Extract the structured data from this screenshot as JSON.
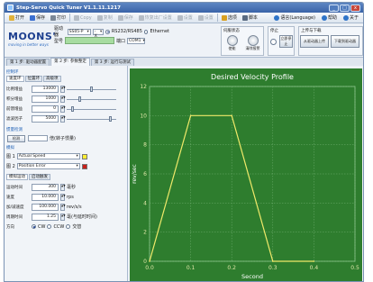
{
  "window": {
    "title": "Step-Servo Quick Tuner V1.1.11.1217",
    "buttons": {
      "minimize": "_",
      "maximize": "□",
      "close": "x"
    }
  },
  "toolbar": {
    "items": [
      {
        "label": "打开",
        "color": "#e1b23a",
        "enabled": true
      },
      {
        "label": "保存",
        "color": "#3b6fd0",
        "enabled": true
      },
      {
        "label": "打印",
        "color": "#7b8796",
        "enabled": true
      },
      {
        "label": "Copy",
        "color": "#b5bcc5",
        "enabled": false
      },
      {
        "label": "复制",
        "color": "#b5bcc5",
        "enabled": false
      },
      {
        "label": "保存",
        "color": "#b5bcc5",
        "enabled": false
      },
      {
        "label": "恢复出厂设置",
        "color": "#b5bcc5",
        "enabled": false
      },
      {
        "label": "设置",
        "color": "#b5bcc5",
        "enabled": false
      },
      {
        "label": "设置",
        "color": "#b5bcc5",
        "enabled": false
      },
      {
        "label": "选项",
        "color": "#d9a021",
        "enabled": true
      },
      {
        "label": "脚本",
        "color": "#5a6b82",
        "enabled": true
      }
    ],
    "right": [
      {
        "label": "语言(Language)",
        "color": "#2f74c8"
      },
      {
        "label": "帮助",
        "color": "#2f74c8"
      },
      {
        "label": "关于",
        "color": "#2f74c8"
      }
    ]
  },
  "config": {
    "brand": "MOONS'",
    "tagline": "moving in better ways",
    "drive_label": "驱动器",
    "drive_value": "SS05-P",
    "drive_option": "-X",
    "comm_options": [
      "RS232/RS485",
      "Ethernet"
    ],
    "selected_comm": "RS232/RS485",
    "model_label": "型号",
    "port_label": "端口",
    "port_value": "COM1",
    "status_group": {
      "title": "伺服状态",
      "buttons": [
        "使能",
        "清除报警"
      ]
    },
    "stop_group": {
      "title": "停止",
      "button": "立即停止"
    },
    "upload_group": {
      "title": "上传与下载",
      "buttons": [
        "从驱动器上传",
        "下载到驱动器"
      ]
    }
  },
  "steps": [
    {
      "label": "第 1 步: 驱动器配置",
      "active": false
    },
    {
      "label": "第 2 步: 参数整定",
      "active": true
    },
    {
      "label": "第 3 步: 运行与测试",
      "active": false
    }
  ],
  "left": {
    "section_controller": "控制环",
    "subtabs": [
      {
        "label": "速度环",
        "active": true
      },
      {
        "label": "位置环",
        "active": false
      },
      {
        "label": "高级项",
        "active": false
      }
    ],
    "params": [
      {
        "label": "比例增益",
        "value": "13000",
        "slider": 0.5
      },
      {
        "label": "积分增益",
        "value": "1000",
        "slider": 0.25
      },
      {
        "label": "前馈增益",
        "value": "0",
        "slider": 0.1
      },
      {
        "label": "滤波因子",
        "value": "5000",
        "slider": 0.9
      }
    ],
    "section_inertia": "惯量检测",
    "inertia_button": "检测",
    "inertia_result": "倍(转子惯量)",
    "section_sim": "模拟",
    "traces": [
      {
        "label": "图 1",
        "value": "Actual Speed",
        "color": "#ffee33"
      },
      {
        "label": "图 2",
        "value": "Position Error",
        "color": "#c8201a"
      }
    ],
    "motion_tabs": [
      {
        "label": "模拟运动",
        "active": true
      },
      {
        "label": "启动触发",
        "active": false
      }
    ],
    "motion": [
      {
        "label": "运动时间",
        "value": "300",
        "unit": "毫秒"
      },
      {
        "label": "速度",
        "value": "10.000",
        "unit": "rps"
      },
      {
        "label": "加/减速度",
        "value": "100.000",
        "unit": "rev/s/s"
      },
      {
        "label": "周期时间",
        "value": "1.25",
        "unit": "毫(与延时时间)"
      }
    ],
    "direction_label": "方向",
    "directions": [
      "CW",
      "CCW",
      "交替"
    ],
    "selected_direction": "CW"
  },
  "chart_data": {
    "type": "line",
    "title": "Desired Velocity Profile",
    "xlabel": "Second",
    "ylabel": "rev/sec",
    "xlim": [
      0,
      0.5
    ],
    "ylim": [
      0,
      12
    ],
    "xticks": [
      "0.0",
      "0.1",
      "0.2",
      "0.3",
      "0.4",
      "0.5"
    ],
    "yticks": [
      "0",
      "2",
      "4",
      "6",
      "8",
      "10",
      "12"
    ],
    "grid": true,
    "background": "#2e7d2e",
    "line_color": "#f0e96a",
    "series": [
      {
        "name": "",
        "x": [
          0.0,
          0.1,
          0.2,
          0.3,
          0.4
        ],
        "y": [
          0,
          10,
          10,
          0,
          0
        ]
      }
    ]
  }
}
